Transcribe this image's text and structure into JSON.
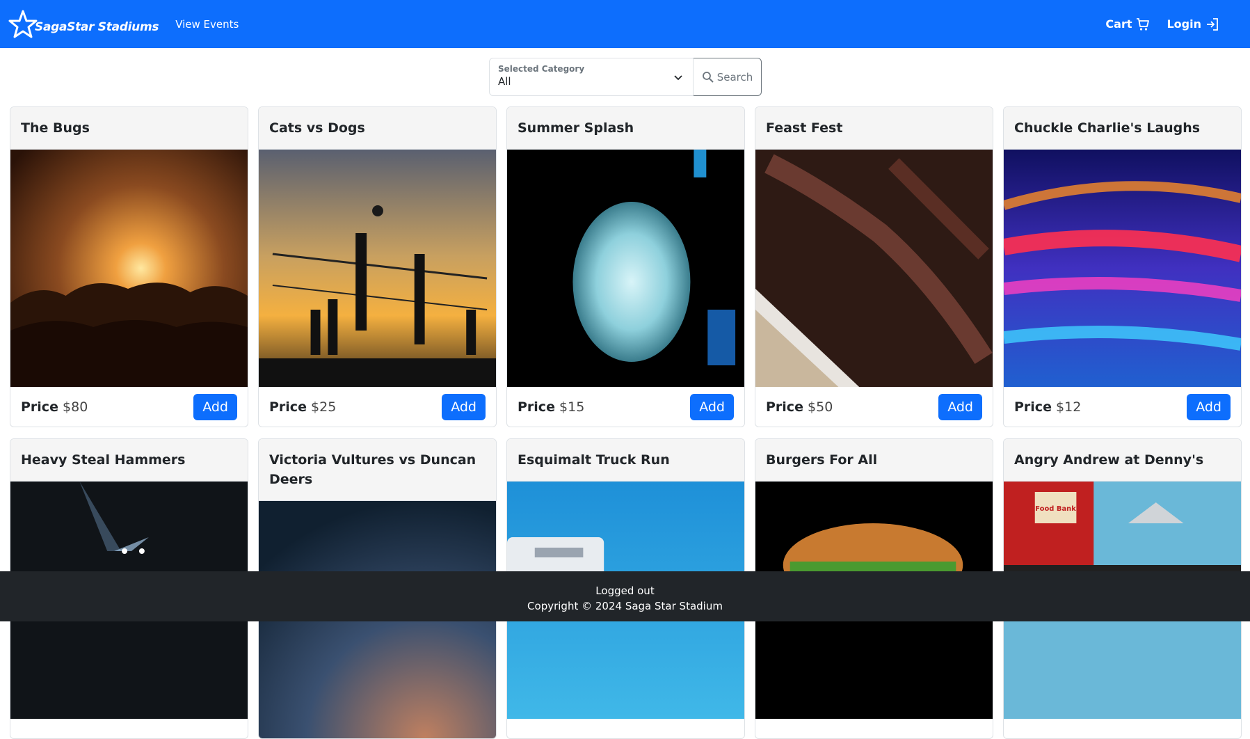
{
  "nav": {
    "brand": "SagaStar Stadiums",
    "view_events": "View Events",
    "cart": "Cart",
    "login": "Login"
  },
  "search": {
    "category_label": "Selected Category",
    "category_value": "All",
    "button": "Search"
  },
  "events": [
    {
      "title": "The Bugs",
      "price_label": "Price",
      "price": "$80",
      "add": "Add",
      "image": "concert-crowd"
    },
    {
      "title": "Cats vs Dogs",
      "price_label": "Price",
      "price": "$25",
      "add": "Add",
      "image": "beach-volleyball-sunset"
    },
    {
      "title": "Summer Splash",
      "price_label": "Price",
      "price": "$15",
      "add": "Add",
      "image": "water-balloon-splash"
    },
    {
      "title": "Feast Fest",
      "price_label": "Price",
      "price": "$50",
      "add": "Add",
      "image": "grilled-ribs"
    },
    {
      "title": "Chuckle Charlie's Laughs",
      "price_label": "Price",
      "price": "$12",
      "add": "Add",
      "image": "neon-lights"
    },
    {
      "title": "Heavy Steal Hammers",
      "image": "stage-spotlights"
    },
    {
      "title": "Victoria Vultures vs Duncan Deers",
      "image": "stadium-crowd"
    },
    {
      "title": "Esquimalt Truck Run",
      "image": "truck-blue-sky"
    },
    {
      "title": "Burgers For All",
      "image": "burger"
    },
    {
      "title": "Angry Andrew at Denny's",
      "image": "retro-diner",
      "sign": "Food Bank"
    }
  ],
  "footer": {
    "status": "Logged out",
    "copyright": "Copyright © 2024 Saga Star Stadium"
  },
  "colors": {
    "primary": "#0d6efd",
    "footer_bg": "#212529"
  }
}
